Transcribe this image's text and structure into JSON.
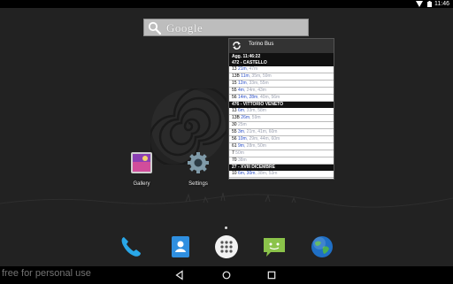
{
  "status_bar": {
    "time": "11:46"
  },
  "search": {
    "label": "Google"
  },
  "home_apps": [
    {
      "label": "Gallery"
    },
    {
      "label": "Settings"
    }
  ],
  "widget": {
    "title": "Torino Bus",
    "updated": "Agg. 11:46:22",
    "stops": [
      {
        "name": "472 - CASTELLO",
        "lines": [
          {
            "id": "13",
            "rt": "21m",
            "st": ", 47m"
          },
          {
            "id": "13B",
            "rt": "11m",
            "st": ", 35m, 59m"
          },
          {
            "id": "15",
            "rt": "12m",
            "st": ", 33m, 55m"
          },
          {
            "id": "55",
            "rt": "4m",
            "st": ", 24m, 43m"
          },
          {
            "id": "56",
            "rt": "14m, 28m",
            "st": ", 40m, 56m"
          }
        ]
      },
      {
        "name": "476 - VITTORIO VENETO",
        "lines": [
          {
            "id": "13",
            "rt": "6m",
            "st": ", 33m, 58m"
          },
          {
            "id": "13B",
            "rt": "26m",
            "st": ", 59m"
          },
          {
            "id": "30",
            "rt": "",
            "st": "25m"
          },
          {
            "id": "55",
            "rt": "3m",
            "st": ", 21m, 41m, 60m"
          },
          {
            "id": "56",
            "rt": "10m",
            "st": ", 29m, 44m, 60m"
          },
          {
            "id": "61",
            "rt": "9m",
            "st": ", 28m, 50m"
          },
          {
            "id": "7",
            "rt": "",
            "st": "50m"
          },
          {
            "id": "70",
            "rt": "",
            "st": "38m"
          }
        ]
      },
      {
        "name": "27 - XVIII DICEMBRE",
        "lines": [
          {
            "id": "10",
            "rt": "6m, 30m",
            "st": ", 38m, 53m"
          }
        ]
      }
    ]
  },
  "watermark": "free for personal use",
  "colors": {
    "realtime": "#2a4fc9",
    "scheduled": "#9aa0b0"
  }
}
